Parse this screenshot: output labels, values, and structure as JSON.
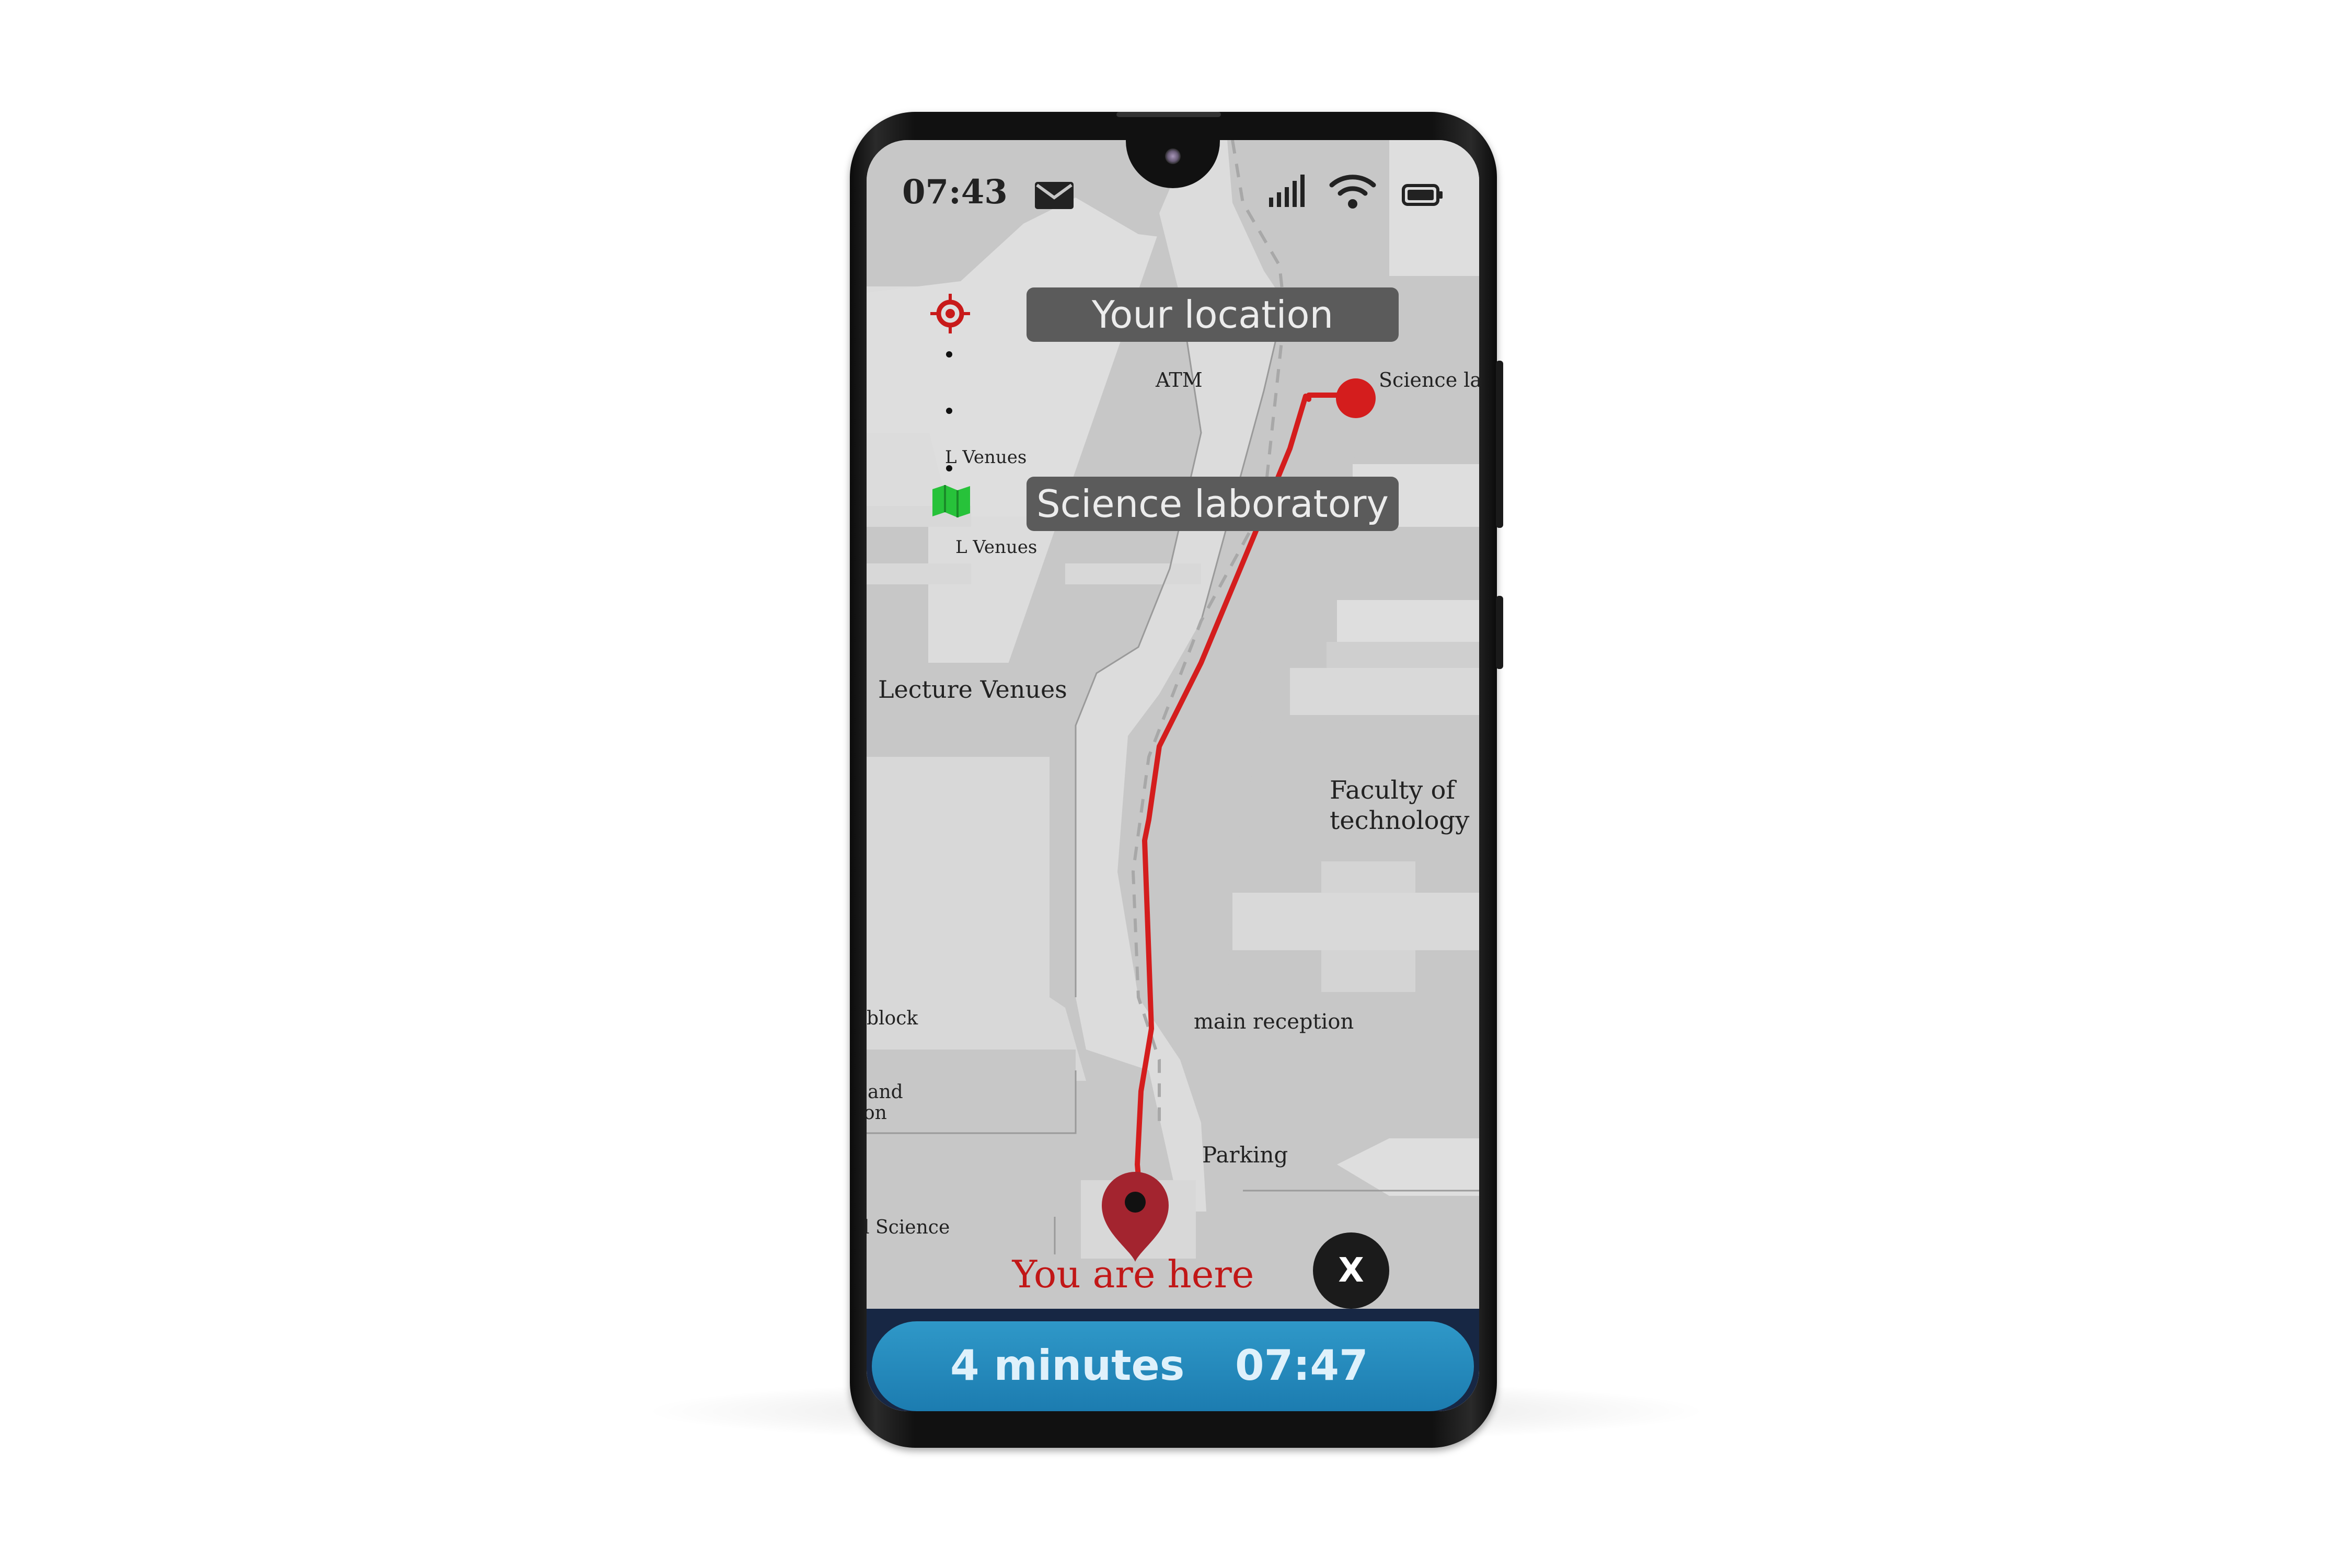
{
  "status_bar": {
    "time": "07:43",
    "icons": [
      "mail-icon",
      "signal-icon",
      "wifi-icon",
      "battery-icon"
    ]
  },
  "map": {
    "callouts": {
      "your_location": "Your location",
      "destination": "Science laboratory"
    },
    "labels": {
      "atm": "ATM",
      "science_lab": "Science la",
      "l_venues_top": "L Venues",
      "l_venues_bottom": "L Venues",
      "lecture_venues": "Lecture Venues",
      "faculty_line1": "Faculty of",
      "faculty_line2": "technology",
      "block": "block",
      "main_reception": "main reception",
      "and": "and",
      "on": "on",
      "parking": "Parking",
      "science": "l Science"
    },
    "you_are_here": "You are here",
    "route_color": "#d41d1d",
    "icons": [
      "location-target-icon",
      "map-icon",
      "destination-pin-icon",
      "current-location-pin-icon"
    ]
  },
  "controls": {
    "close_label": "X"
  },
  "eta": {
    "duration": "4 minutes",
    "arrival_time": "07:47"
  },
  "colors": {
    "accent": "#2f98c8",
    "route": "#d41d1d",
    "map_background": "#c6c6c6",
    "road": "#dedede",
    "callout": "#5b5b5b"
  }
}
